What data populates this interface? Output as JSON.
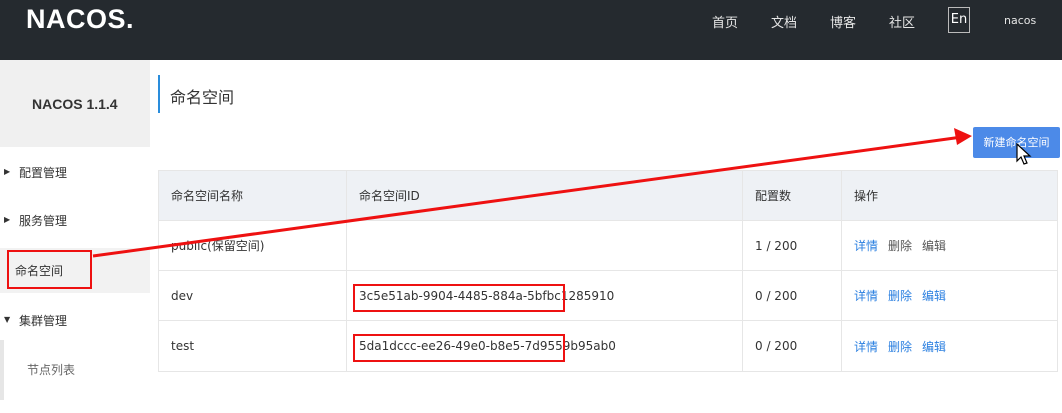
{
  "header": {
    "logo": "NACOS.",
    "nav": [
      "首页",
      "文档",
      "博客",
      "社区"
    ],
    "lang": "En",
    "user": "nacos"
  },
  "sidebar": {
    "version": "NACOS 1.1.4",
    "items": [
      {
        "label": "配置管理",
        "arrow": "▶"
      },
      {
        "label": "服务管理",
        "arrow": "▶"
      },
      {
        "label": "命名空间",
        "arrow": ""
      },
      {
        "label": "集群管理",
        "arrow": "▼"
      },
      {
        "label": "节点列表",
        "arrow": ""
      }
    ]
  },
  "page": {
    "title": "命名空间",
    "new_button": "新建命名空间"
  },
  "table": {
    "headers": [
      "命名空间名称",
      "命名空间ID",
      "配置数",
      "操作"
    ],
    "rows": [
      {
        "name": "public(保留空间)",
        "id": "",
        "count": "1 / 200",
        "ops": [
          "详情",
          "删除",
          "编辑"
        ]
      },
      {
        "name": "dev",
        "id": "3c5e51ab-9904-4485-884a-5bfbc1285910",
        "count": "0 / 200",
        "ops": [
          "详情",
          "删除",
          "编辑"
        ]
      },
      {
        "name": "test",
        "id": "5da1dccc-ee26-49e0-b8e5-7d9559b95ab0",
        "count": "0 / 200",
        "ops": [
          "详情",
          "删除",
          "编辑"
        ]
      }
    ]
  },
  "colors": {
    "topbar": "#252a2f",
    "accent": "#4c8ae8",
    "annotation": "#e11111"
  }
}
